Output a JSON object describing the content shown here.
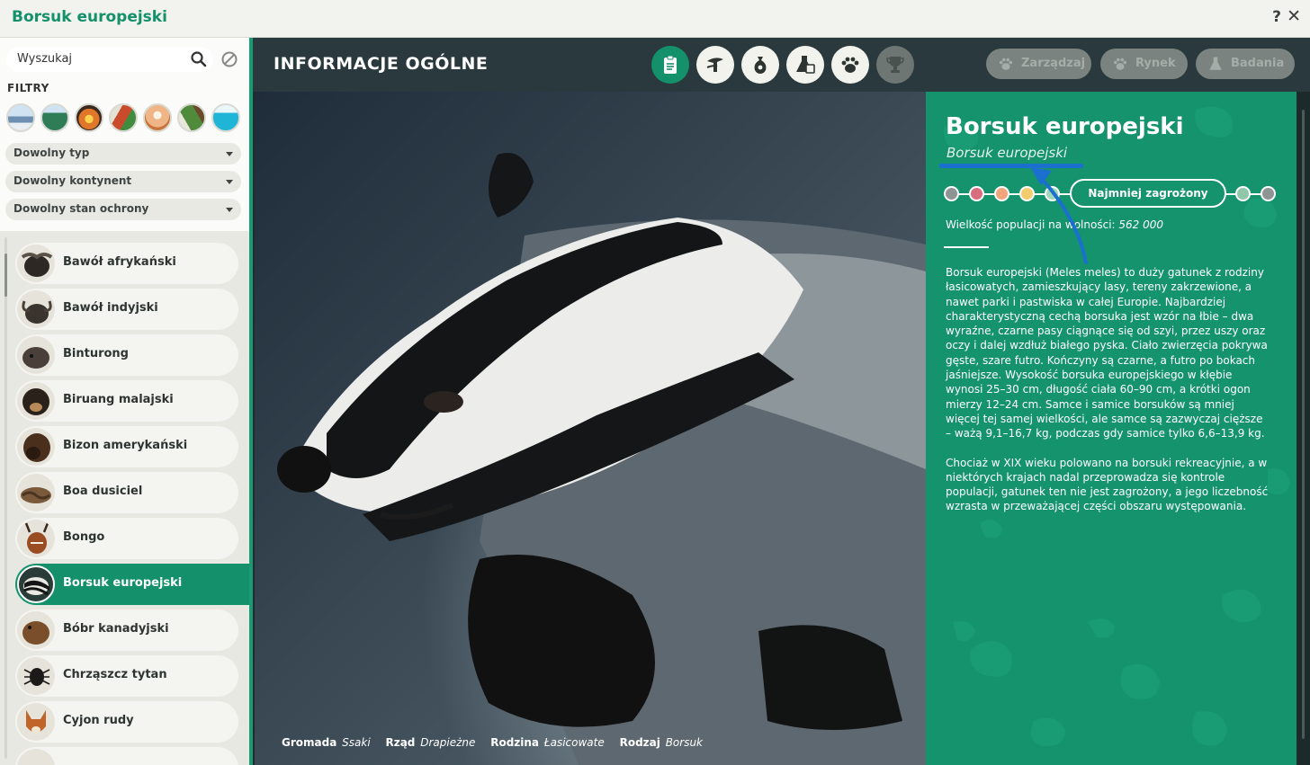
{
  "window": {
    "title": "Borsuk europejski",
    "help": "?",
    "close": "✕"
  },
  "sidebar": {
    "search_placeholder": "Wyszukaj",
    "filters_label": "FILTRY",
    "biomes": [
      {
        "icon": "tundra-biome-icon",
        "color": "#7fa3c6"
      },
      {
        "icon": "temperate-biome-icon",
        "color": "#3d8a5f"
      },
      {
        "icon": "grassland-biome-icon",
        "color": "#e0762a"
      },
      {
        "icon": "tropical-biome-icon",
        "color": "#c94b2c"
      },
      {
        "icon": "desert-biome-icon",
        "color": "#e9a36a"
      },
      {
        "icon": "taiga-biome-icon",
        "color": "#4f8b3a"
      },
      {
        "icon": "aquatic-biome-icon",
        "color": "#1fb5d6"
      }
    ],
    "type_dropdown": "Dowolny typ",
    "continent_dropdown": "Dowolny kontynent",
    "conservation_dropdown": "Dowolny stan ochrony",
    "animals": [
      {
        "name": "Bawół afrykański",
        "icon": "african-buffalo-icon"
      },
      {
        "name": "Bawół indyjski",
        "icon": "water-buffalo-icon"
      },
      {
        "name": "Binturong",
        "icon": "binturong-icon"
      },
      {
        "name": "Biruang malajski",
        "icon": "sun-bear-icon"
      },
      {
        "name": "Bizon amerykański",
        "icon": "bison-icon"
      },
      {
        "name": "Boa dusiciel",
        "icon": "boa-icon"
      },
      {
        "name": "Bongo",
        "icon": "bongo-icon"
      },
      {
        "name": "Borsuk europejski",
        "icon": "badger-icon"
      },
      {
        "name": "Bóbr kanadyjski",
        "icon": "beaver-icon"
      },
      {
        "name": "Chrząszcz tytan",
        "icon": "titan-beetle-icon"
      },
      {
        "name": "Cyjon rudy",
        "icon": "dhole-icon"
      }
    ],
    "selected_index": 7
  },
  "header": {
    "heading": "INFORMACJE OGÓLNE",
    "tabs": [
      {
        "icon": "clipboard-icon",
        "state": "active"
      },
      {
        "icon": "habitat-icon",
        "state": "normal"
      },
      {
        "icon": "food-sack-icon",
        "state": "normal"
      },
      {
        "icon": "enrichment-icon",
        "state": "normal"
      },
      {
        "icon": "paw-icon",
        "state": "normal"
      },
      {
        "icon": "trophy-icon",
        "state": "disabled"
      }
    ],
    "nav_buttons": [
      {
        "label": "Zarządzaj",
        "icon": "paw-icon"
      },
      {
        "label": "Rynek",
        "icon": "paw-icon"
      },
      {
        "label": "Badania",
        "icon": "flask-icon"
      }
    ]
  },
  "photo": {
    "taxonomy": [
      {
        "label": "Gromada",
        "value": "Ssaki"
      },
      {
        "label": "Rząd",
        "value": "Drapieżne"
      },
      {
        "label": "Rodzina",
        "value": "Łasicowate"
      },
      {
        "label": "Rodzaj",
        "value": "Borsuk"
      }
    ]
  },
  "info": {
    "name": "Borsuk europejski",
    "latin": "Borsuk europejski",
    "status_label": "Najmniej zagrożony",
    "status_dots": [
      "#8d9491",
      "#d86d7e",
      "#f0a57a",
      "#f1cc6c",
      "#9fd7b9",
      "#8fc7a8",
      "#8d9491"
    ],
    "population_label": "Wielkość populacji na wolności:",
    "population_value": "562 000",
    "description": [
      "Borsuk europejski (Meles meles) to duży gatunek z rodziny łasicowatych, zamieszkujący lasy, tereny zakrzewione, a nawet parki i pastwiska w całej Europie. Najbardziej charakterystyczną cechą borsuka jest wzór na łbie – dwa wyraźne, czarne pasy ciągnące się od szyi, przez uszy oraz oczy i dalej wzdłuż białego pyska. Ciało zwierzęcia pokrywa gęste, szare futro. Kończyny są czarne, a futro po bokach jaśniejsze. Wysokość borsuka europejskiego w kłębie wynosi 25–30 cm, długość ciała 60–90 cm, a krótki ogon mierzy 12–24 cm. Samce i samice borsuków są mniej więcej tej samej wielkości, ale samce są zazwyczaj cięższe – ważą 9,1–16,7 kg, podczas gdy samice tylko 6,6–13,9 kg.",
      "Chociaż w XIX wieku polowano na borsuki rekreacyjnie, a w niektórych krajach nadal przeprowadza się kontrole populacji, gatunek ten nie jest zagrożony, a jego liczebność wzrasta w przeważającej części obszaru występowania."
    ],
    "annotation_color": "#1b6fcf"
  }
}
